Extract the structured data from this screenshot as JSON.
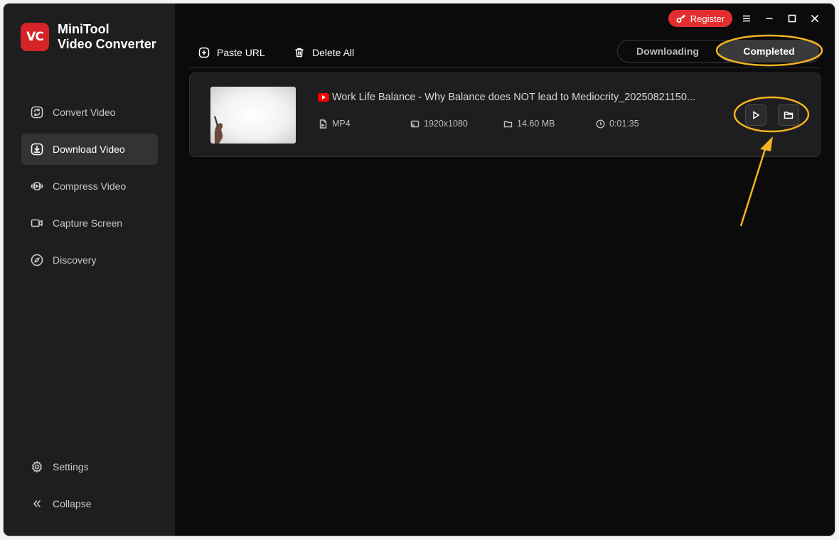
{
  "app": {
    "logo_text": "VC",
    "name_line1": "MiniTool",
    "name_line2": "Video Converter"
  },
  "sidebar": {
    "items": [
      {
        "label": "Convert Video",
        "icon": "convert-icon"
      },
      {
        "label": "Download Video",
        "icon": "download-icon",
        "active": true
      },
      {
        "label": "Compress Video",
        "icon": "compress-icon"
      },
      {
        "label": "Capture Screen",
        "icon": "camera-icon"
      },
      {
        "label": "Discovery",
        "icon": "compass-icon"
      }
    ],
    "bottom": [
      {
        "label": "Settings",
        "icon": "gear-icon"
      },
      {
        "label": "Collapse",
        "icon": "double-chevron-left-icon"
      }
    ]
  },
  "titlebar": {
    "register_label": "Register"
  },
  "toolbar": {
    "paste_url_label": "Paste URL",
    "delete_all_label": "Delete All"
  },
  "tabs": {
    "downloading": "Downloading",
    "completed": "Completed",
    "active": "completed"
  },
  "downloads": [
    {
      "title": "Work Life Balance - Why Balance does NOT lead to Mediocrity_20250821150...",
      "format": "MP4",
      "resolution": "1920x1080",
      "size": "14.60 MB",
      "duration": "0:01:35"
    }
  ],
  "colors": {
    "accent_red": "#e32e2f",
    "annotation": "#f5b41e",
    "background": "#0b0b0c",
    "sidebar": "#1e1e1f"
  }
}
